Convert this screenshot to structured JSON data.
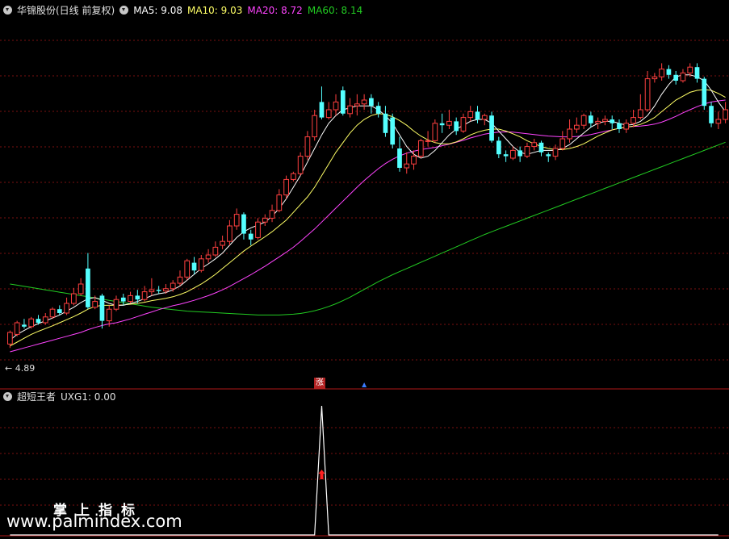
{
  "header": {
    "stock_name": "华锦股份(日线 前复权)",
    "ma5": "MA5: 9.08",
    "ma10": "MA10: 9.03",
    "ma20": "MA20: 8.72",
    "ma60": "MA60: 8.14"
  },
  "colors": {
    "up": "#ff4040",
    "down": "#54ffff",
    "ma5": "#ffffff",
    "ma10": "#ffff66",
    "ma20": "#ff44ff",
    "ma60": "#22cc22",
    "grid": "#7a1010",
    "border": "#b01818"
  },
  "price_label_low": "4.89",
  "signal_label": "涨",
  "indicator": {
    "name": "超短王者",
    "value_text": "UXG1: 0.00"
  },
  "watermark": {
    "cn": "掌上指标",
    "url": "www.palmindex.com"
  },
  "chart_data": {
    "type": "candlestick",
    "ylim": [
      4.6,
      11.6
    ],
    "candles": [
      [
        5.05,
        5.35,
        4.95,
        5.4
      ],
      [
        5.3,
        5.6,
        5.25,
        5.65
      ],
      [
        5.55,
        5.5,
        5.45,
        5.7
      ],
      [
        5.5,
        5.7,
        5.45,
        5.75
      ],
      [
        5.7,
        5.6,
        5.55,
        5.8
      ],
      [
        5.6,
        5.75,
        5.55,
        5.85
      ],
      [
        5.75,
        5.95,
        5.7,
        6.0
      ],
      [
        5.95,
        5.85,
        5.8,
        6.05
      ],
      [
        5.85,
        6.1,
        5.8,
        6.25
      ],
      [
        6.1,
        6.35,
        6.05,
        6.5
      ],
      [
        6.35,
        6.6,
        6.3,
        6.75
      ],
      [
        7.0,
        6.0,
        5.95,
        7.4
      ],
      [
        6.0,
        6.15,
        5.95,
        6.3
      ],
      [
        6.3,
        5.65,
        5.45,
        6.35
      ],
      [
        5.65,
        5.95,
        5.5,
        6.05
      ],
      [
        5.95,
        6.2,
        5.9,
        6.3
      ],
      [
        6.25,
        6.15,
        6.05,
        6.35
      ],
      [
        6.15,
        6.3,
        6.1,
        6.4
      ],
      [
        6.3,
        6.2,
        6.1,
        6.45
      ],
      [
        6.2,
        6.4,
        6.15,
        6.55
      ],
      [
        6.4,
        6.45,
        6.3,
        6.75
      ],
      [
        6.45,
        6.42,
        6.35,
        6.55
      ],
      [
        6.42,
        6.48,
        6.35,
        6.6
      ],
      [
        6.48,
        6.62,
        6.4,
        6.7
      ],
      [
        6.62,
        6.78,
        6.55,
        6.95
      ],
      [
        6.78,
        7.2,
        6.7,
        7.25
      ],
      [
        7.15,
        6.95,
        6.85,
        7.3
      ],
      [
        6.95,
        7.25,
        6.9,
        7.35
      ],
      [
        7.25,
        7.35,
        7.15,
        7.5
      ],
      [
        7.35,
        7.55,
        7.3,
        7.7
      ],
      [
        7.6,
        7.7,
        7.5,
        7.85
      ],
      [
        7.7,
        8.1,
        7.6,
        8.25
      ],
      [
        8.1,
        8.4,
        8.0,
        8.55
      ],
      [
        8.4,
        7.9,
        7.75,
        8.45
      ],
      [
        7.9,
        7.75,
        7.6,
        8.0
      ],
      [
        7.8,
        8.2,
        7.75,
        8.3
      ],
      [
        8.2,
        8.3,
        8.1,
        8.4
      ],
      [
        8.3,
        8.5,
        8.2,
        8.65
      ],
      [
        8.5,
        8.9,
        8.45,
        9.05
      ],
      [
        8.9,
        9.3,
        8.8,
        9.4
      ],
      [
        9.3,
        9.45,
        9.25,
        9.5
      ],
      [
        9.45,
        9.9,
        9.4,
        10.0
      ],
      [
        9.9,
        10.4,
        9.8,
        10.55
      ],
      [
        10.4,
        10.95,
        10.3,
        11.1
      ],
      [
        11.3,
        10.9,
        10.85,
        11.7
      ],
      [
        10.9,
        11.1,
        10.85,
        11.3
      ],
      [
        11.1,
        11.3,
        10.95,
        11.5
      ],
      [
        11.6,
        11.0,
        10.95,
        11.7
      ],
      [
        11.0,
        11.2,
        10.9,
        11.4
      ],
      [
        11.2,
        11.25,
        10.95,
        11.5
      ],
      [
        11.25,
        11.35,
        11.1,
        11.5
      ],
      [
        11.4,
        11.2,
        11.0,
        11.5
      ],
      [
        11.2,
        11.0,
        10.9,
        11.3
      ],
      [
        11.0,
        10.5,
        10.4,
        11.2
      ],
      [
        10.9,
        10.2,
        10.1,
        11.0
      ],
      [
        10.1,
        9.6,
        9.5,
        10.4
      ],
      [
        9.6,
        9.7,
        9.45,
        10.0
      ],
      [
        9.7,
        9.9,
        9.55,
        10.05
      ],
      [
        9.9,
        10.3,
        9.85,
        10.35
      ],
      [
        10.3,
        10.3,
        10.15,
        10.55
      ],
      [
        10.3,
        10.75,
        10.25,
        10.85
      ],
      [
        10.75,
        10.7,
        10.5,
        11.0
      ],
      [
        10.7,
        10.8,
        10.6,
        11.1
      ],
      [
        10.8,
        10.55,
        10.45,
        10.9
      ],
      [
        10.55,
        10.9,
        10.5,
        11.0
      ],
      [
        10.9,
        11.05,
        10.8,
        11.2
      ],
      [
        11.05,
        10.85,
        10.75,
        11.2
      ],
      [
        10.85,
        10.95,
        10.7,
        11.0
      ],
      [
        10.95,
        10.3,
        10.25,
        11.05
      ],
      [
        10.3,
        9.95,
        9.85,
        10.4
      ],
      [
        9.95,
        9.9,
        9.75,
        10.05
      ],
      [
        9.85,
        10.05,
        9.8,
        10.15
      ],
      [
        10.05,
        9.9,
        9.75,
        10.15
      ],
      [
        9.9,
        10.15,
        9.85,
        10.25
      ],
      [
        10.15,
        10.25,
        10.05,
        10.35
      ],
      [
        10.25,
        10.0,
        9.9,
        10.3
      ],
      [
        9.95,
        9.9,
        9.75,
        10.0
      ],
      [
        9.9,
        10.1,
        9.8,
        10.2
      ],
      [
        10.1,
        10.35,
        10.05,
        10.55
      ],
      [
        10.35,
        10.6,
        10.25,
        10.85
      ],
      [
        10.6,
        10.7,
        10.5,
        10.9
      ],
      [
        10.7,
        10.95,
        10.6,
        11.0
      ],
      [
        10.95,
        10.75,
        10.65,
        11.05
      ],
      [
        10.75,
        10.8,
        10.6,
        10.9
      ],
      [
        10.8,
        10.85,
        10.7,
        10.95
      ],
      [
        10.85,
        10.75,
        10.6,
        10.95
      ],
      [
        10.75,
        10.6,
        10.5,
        10.85
      ],
      [
        10.6,
        10.75,
        10.5,
        10.85
      ],
      [
        10.75,
        10.9,
        10.65,
        11.1
      ],
      [
        10.9,
        11.1,
        10.85,
        11.5
      ],
      [
        11.1,
        11.9,
        11.05,
        12.1
      ],
      [
        11.9,
        11.95,
        11.8,
        12.05
      ],
      [
        11.95,
        12.15,
        11.85,
        12.3
      ],
      [
        12.15,
        12.0,
        11.9,
        12.25
      ],
      [
        12.0,
        11.85,
        11.75,
        12.1
      ],
      [
        11.85,
        12.05,
        11.8,
        12.15
      ],
      [
        12.05,
        12.2,
        11.95,
        12.3
      ],
      [
        12.2,
        11.9,
        11.8,
        12.3
      ],
      [
        11.9,
        11.2,
        11.1,
        11.95
      ],
      [
        11.2,
        10.75,
        10.65,
        11.3
      ],
      [
        10.75,
        10.85,
        10.6,
        11.05
      ],
      [
        10.85,
        11.1,
        10.75,
        11.3
      ]
    ],
    "ma5": [
      5.15,
      5.3,
      5.4,
      5.5,
      5.58,
      5.65,
      5.72,
      5.8,
      5.9,
      6.0,
      6.12,
      6.22,
      6.25,
      6.18,
      6.1,
      6.05,
      6.05,
      6.1,
      6.15,
      6.22,
      6.3,
      6.35,
      6.38,
      6.45,
      6.55,
      6.7,
      6.85,
      7.0,
      7.12,
      7.25,
      7.4,
      7.6,
      7.8,
      7.95,
      8.05,
      8.12,
      8.2,
      8.35,
      8.55,
      8.8,
      9.1,
      9.4,
      9.75,
      10.1,
      10.45,
      10.75,
      10.95,
      11.1,
      11.15,
      11.2,
      11.2,
      11.2,
      11.1,
      10.95,
      10.75,
      10.45,
      10.15,
      9.95,
      9.85,
      9.9,
      10.05,
      10.25,
      10.45,
      10.6,
      10.7,
      10.8,
      10.85,
      10.85,
      10.75,
      10.55,
      10.35,
      10.15,
      10.0,
      9.95,
      10.0,
      10.05,
      10.05,
      10.05,
      10.1,
      10.2,
      10.35,
      10.5,
      10.65,
      10.75,
      10.8,
      10.8,
      10.75,
      10.7,
      10.72,
      10.8,
      10.95,
      11.2,
      11.5,
      11.75,
      11.95,
      12.0,
      12.0,
      11.95,
      11.85,
      11.6,
      11.3,
      11.05
    ],
    "ma10": [
      5.0,
      5.1,
      5.2,
      5.3,
      5.38,
      5.45,
      5.52,
      5.6,
      5.68,
      5.76,
      5.85,
      5.95,
      6.02,
      6.05,
      6.05,
      6.05,
      6.06,
      6.08,
      6.1,
      6.13,
      6.17,
      6.2,
      6.23,
      6.27,
      6.33,
      6.4,
      6.5,
      6.6,
      6.72,
      6.85,
      7.0,
      7.15,
      7.3,
      7.45,
      7.58,
      7.7,
      7.82,
      7.95,
      8.1,
      8.25,
      8.45,
      8.65,
      8.85,
      9.1,
      9.4,
      9.7,
      10.0,
      10.25,
      10.5,
      10.7,
      10.85,
      10.95,
      11.0,
      10.98,
      10.92,
      10.82,
      10.7,
      10.55,
      10.42,
      10.32,
      10.25,
      10.22,
      10.22,
      10.27,
      10.35,
      10.45,
      10.52,
      10.57,
      10.6,
      10.6,
      10.55,
      10.48,
      10.4,
      10.3,
      10.22,
      10.15,
      10.1,
      10.07,
      10.07,
      10.1,
      10.15,
      10.22,
      10.32,
      10.42,
      10.5,
      10.58,
      10.62,
      10.65,
      10.68,
      10.72,
      10.8,
      10.9,
      11.05,
      11.2,
      11.35,
      11.45,
      11.55,
      11.6,
      11.62,
      11.6,
      11.52,
      11.42
    ],
    "ma20": [
      4.85,
      4.9,
      4.95,
      5.0,
      5.05,
      5.1,
      5.15,
      5.2,
      5.25,
      5.3,
      5.35,
      5.42,
      5.48,
      5.53,
      5.57,
      5.6,
      5.65,
      5.7,
      5.76,
      5.82,
      5.88,
      5.94,
      5.99,
      6.04,
      6.08,
      6.13,
      6.18,
      6.24,
      6.3,
      6.37,
      6.45,
      6.54,
      6.64,
      6.74,
      6.84,
      6.95,
      7.06,
      7.18,
      7.3,
      7.42,
      7.55,
      7.7,
      7.86,
      8.02,
      8.2,
      8.38,
      8.56,
      8.74,
      8.92,
      9.1,
      9.27,
      9.43,
      9.58,
      9.71,
      9.82,
      9.91,
      9.98,
      10.03,
      10.07,
      10.1,
      10.13,
      10.17,
      10.21,
      10.26,
      10.31,
      10.37,
      10.42,
      10.47,
      10.5,
      10.52,
      10.53,
      10.52,
      10.5,
      10.48,
      10.46,
      10.44,
      10.42,
      10.41,
      10.4,
      10.4,
      10.41,
      10.43,
      10.46,
      10.5,
      10.54,
      10.58,
      10.62,
      10.65,
      10.67,
      10.68,
      10.7,
      10.73,
      10.78,
      10.85,
      10.93,
      11.02,
      11.1,
      11.18,
      11.25,
      11.3,
      11.33,
      11.35
    ],
    "ma60": [
      6.6,
      6.57,
      6.54,
      6.51,
      6.48,
      6.45,
      6.42,
      6.39,
      6.36,
      6.33,
      6.3,
      6.27,
      6.24,
      6.21,
      6.18,
      6.15,
      6.12,
      6.09,
      6.06,
      6.03,
      6.0,
      5.98,
      5.96,
      5.94,
      5.92,
      5.9,
      5.89,
      5.88,
      5.87,
      5.86,
      5.85,
      5.84,
      5.83,
      5.82,
      5.81,
      5.8,
      5.8,
      5.8,
      5.8,
      5.81,
      5.82,
      5.84,
      5.87,
      5.91,
      5.96,
      6.02,
      6.09,
      6.17,
      6.26,
      6.36,
      6.46,
      6.56,
      6.66,
      6.75,
      6.84,
      6.92,
      7.0,
      7.08,
      7.16,
      7.24,
      7.32,
      7.4,
      7.48,
      7.56,
      7.64,
      7.72,
      7.8,
      7.88,
      7.95,
      8.02,
      8.09,
      8.16,
      8.23,
      8.3,
      8.37,
      8.44,
      8.51,
      8.58,
      8.65,
      8.72,
      8.79,
      8.86,
      8.93,
      9.0,
      9.07,
      9.14,
      9.21,
      9.28,
      9.35,
      9.42,
      9.49,
      9.56,
      9.63,
      9.7,
      9.77,
      9.84,
      9.91,
      9.98,
      10.05,
      10.12,
      10.19,
      10.26
    ]
  },
  "indicator_chart": {
    "type": "line",
    "peak_index": 44,
    "max_value": 1.0,
    "values": [
      0,
      0,
      0,
      0,
      0,
      0,
      0,
      0,
      0,
      0,
      0,
      0,
      0,
      0,
      0,
      0,
      0,
      0,
      0,
      0,
      0,
      0,
      0,
      0,
      0,
      0,
      0,
      0,
      0,
      0,
      0,
      0,
      0,
      0,
      0,
      0,
      0,
      0,
      0,
      0,
      0,
      0,
      0,
      0,
      1,
      0,
      0,
      0,
      0,
      0,
      0,
      0,
      0,
      0,
      0,
      0,
      0,
      0,
      0,
      0,
      0,
      0,
      0,
      0,
      0,
      0,
      0,
      0,
      0,
      0,
      0,
      0,
      0,
      0,
      0,
      0,
      0,
      0,
      0,
      0,
      0,
      0,
      0,
      0,
      0,
      0,
      0,
      0,
      0,
      0,
      0,
      0,
      0,
      0,
      0,
      0,
      0,
      0,
      0,
      0,
      0
    ]
  }
}
